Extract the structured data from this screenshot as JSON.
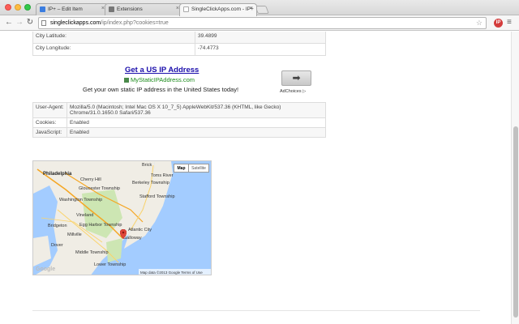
{
  "tabs": [
    {
      "label": "IP+ – Edit Item",
      "active": false,
      "icon_color": "#3b7de0"
    },
    {
      "label": "Extensions",
      "active": false,
      "icon_color": "#777777"
    },
    {
      "label": "SingleClickApps.com - IP+",
      "active": true,
      "icon_color": "#e2a100"
    }
  ],
  "toolbar": {
    "back": "←",
    "forward": "→",
    "reload": "↻",
    "url_domain": "singleclickapps.com",
    "url_path": "/ip/index.php?cookies=true",
    "star": "☆",
    "extension_label": "IP",
    "menu": "≡"
  },
  "location_table": [
    {
      "key": "City Latitude:",
      "value": "39.4899"
    },
    {
      "key": "City Longitude:",
      "value": "-74.4773"
    }
  ],
  "ad": {
    "title": "Get a US IP Address",
    "url": "MyStaticIPAddress.com",
    "description": "Get your own static IP address in the United States today!",
    "button": "➡",
    "adchoices": "AdChoices ▷"
  },
  "browser_table": [
    {
      "key": "User-Agent:",
      "value": "Mozilla/5.0 (Macintosh; Intel Mac OS X 10_7_5) AppleWebKit/537.36 (KHTML, like Gecko) Chrome/31.0.1650.0 Safari/537.36"
    },
    {
      "key": "Cookies:",
      "value": "Enabled"
    },
    {
      "key": "JavaScript:",
      "value": "Enabled"
    }
  ],
  "map": {
    "toggle_map": "Map",
    "toggle_satellite": "Satellite",
    "footer": "Map data ©2013 Google    Terms of Use",
    "logo": "Google",
    "colors": {
      "water": "#a3ccff",
      "land": "#f0ede5",
      "park": "#cde6b3",
      "highway": "#f5a623"
    },
    "labels": [
      {
        "text": "Philadelphia",
        "city": true
      },
      {
        "text": "Cherry Hill",
        "city": false
      },
      {
        "text": "Gloucester Township",
        "city": false
      },
      {
        "text": "Washington Township",
        "city": false
      },
      {
        "text": "Vineland",
        "city": false
      },
      {
        "text": "Egg Harbor Township",
        "city": false
      },
      {
        "text": "Galloway",
        "city": false
      },
      {
        "text": "Atlantic City",
        "city": false
      },
      {
        "text": "Brick",
        "city": false
      },
      {
        "text": "Toms River",
        "city": false
      },
      {
        "text": "Berkeley Township",
        "city": false
      },
      {
        "text": "Stafford Township",
        "city": false
      },
      {
        "text": "Millville",
        "city": false
      },
      {
        "text": "Dover",
        "city": false
      },
      {
        "text": "Middle Township",
        "city": false
      },
      {
        "text": "Lower Township",
        "city": false
      },
      {
        "text": "Bridgeton",
        "city": false
      }
    ]
  }
}
